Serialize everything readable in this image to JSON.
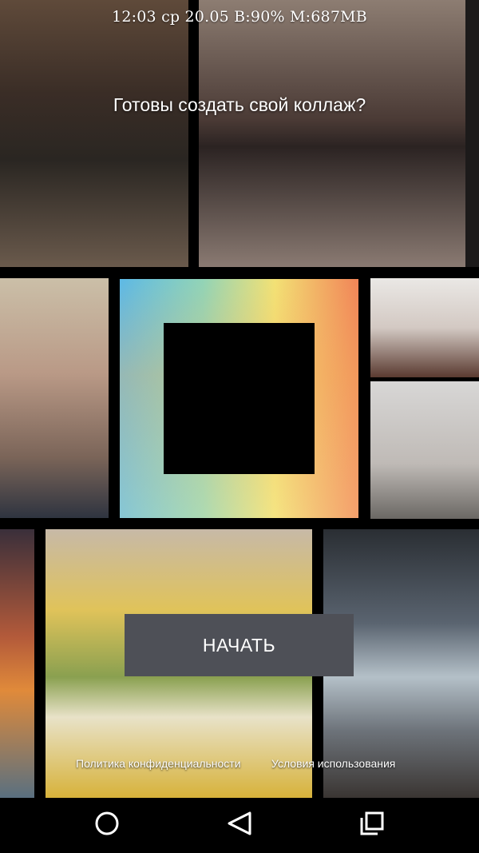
{
  "status_bar": {
    "text": "12:03 ср 20.05 B:90% M:687MB"
  },
  "onboarding": {
    "title": "Готовы создать свой коллаж?",
    "start_button_label": "НАЧАТЬ",
    "privacy_link": "Политика конфиденциальности",
    "terms_link": "Условия использования"
  },
  "navigation_bar": {
    "buttons": [
      {
        "icon": "home-icon"
      },
      {
        "icon": "back-icon"
      },
      {
        "icon": "recents-icon"
      }
    ]
  },
  "colors": {
    "button_bg": "#4e5057",
    "background": "#000000",
    "logo_gradient": [
      "#5db9e6",
      "#8fd3b5",
      "#f2e06e",
      "#f07a4a"
    ]
  }
}
